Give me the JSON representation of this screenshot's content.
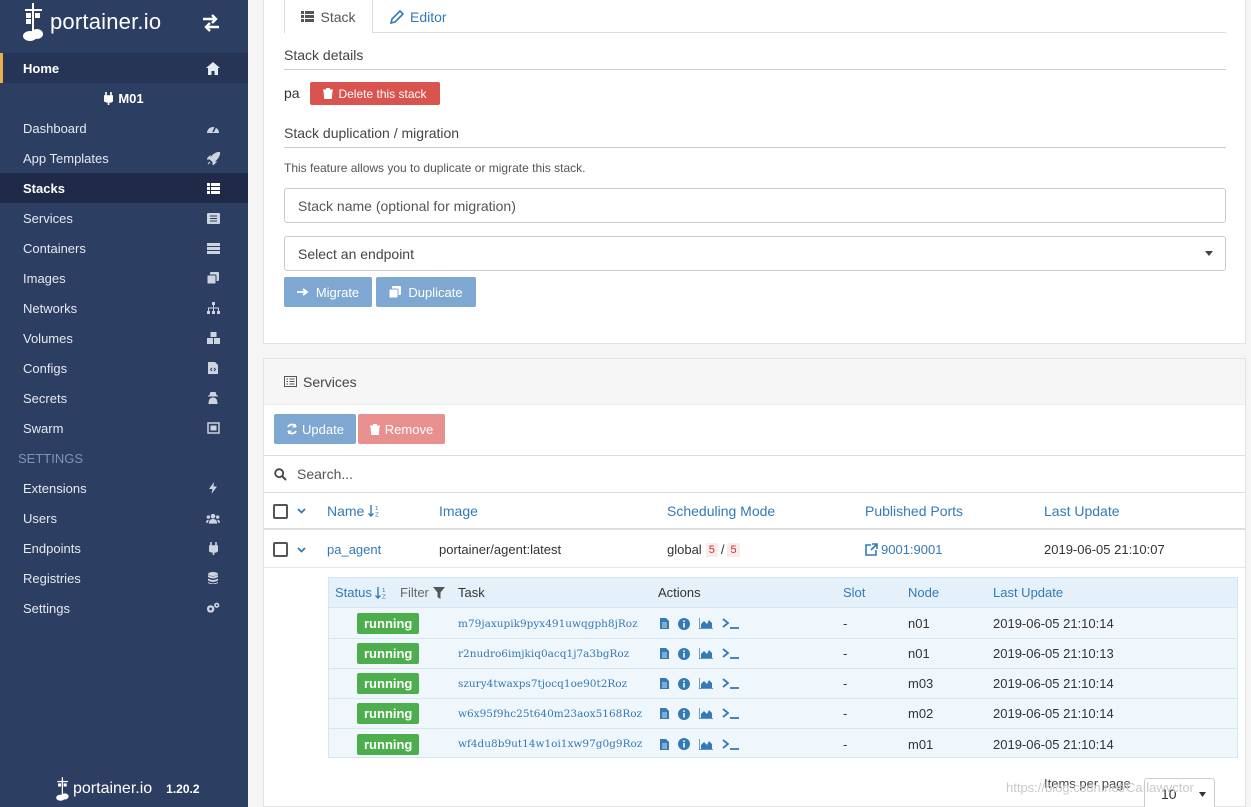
{
  "app": {
    "logo_text": "portainer.io",
    "version": "1.20.2"
  },
  "sidebar": {
    "home": "Home",
    "endpoint": "M01",
    "items": [
      {
        "label": "Dashboard",
        "icon": "tachometer-icon"
      },
      {
        "label": "App Templates",
        "icon": "rocket-icon"
      },
      {
        "label": "Stacks",
        "icon": "th-list-icon"
      },
      {
        "label": "Services",
        "icon": "list-alt-icon"
      },
      {
        "label": "Containers",
        "icon": "server-icon"
      },
      {
        "label": "Images",
        "icon": "clone-icon"
      },
      {
        "label": "Networks",
        "icon": "sitemap-icon"
      },
      {
        "label": "Volumes",
        "icon": "cubes-icon"
      },
      {
        "label": "Configs",
        "icon": "file-code-icon"
      },
      {
        "label": "Secrets",
        "icon": "user-secret-icon"
      },
      {
        "label": "Swarm",
        "icon": "object-group-icon"
      }
    ],
    "settings_header": "SETTINGS",
    "settings_items": [
      {
        "label": "Extensions",
        "icon": "bolt-icon"
      },
      {
        "label": "Users",
        "icon": "users-icon"
      },
      {
        "label": "Endpoints",
        "icon": "plug-icon"
      },
      {
        "label": "Registries",
        "icon": "database-icon"
      },
      {
        "label": "Settings",
        "icon": "cogs-icon"
      }
    ]
  },
  "stack_panel": {
    "tabs": {
      "stack": "Stack",
      "editor": "Editor"
    },
    "details_title": "Stack details",
    "stack_name": "pa",
    "delete_button": "Delete this stack",
    "duplication_title": "Stack duplication / migration",
    "help_text": "This feature allows you to duplicate or migrate this stack.",
    "name_placeholder": "Stack name (optional for migration)",
    "endpoint_select": "Select an endpoint",
    "migrate_button": "Migrate",
    "duplicate_button": "Duplicate"
  },
  "services_panel": {
    "title": "Services",
    "update_button": "Update",
    "remove_button": "Remove",
    "search_placeholder": "Search...",
    "columns": {
      "name": "Name",
      "image": "Image",
      "scheduling": "Scheduling Mode",
      "ports": "Published Ports",
      "last_update": "Last Update"
    },
    "service": {
      "name": "pa_agent",
      "image": "portainer/agent:latest",
      "mode": "global",
      "running": "5",
      "slash": "/",
      "desired": "5",
      "ports": "9001:9001",
      "last_update": "2019-06-05 21:10:07"
    },
    "task_columns": {
      "status": "Status",
      "filter": "Filter",
      "task": "Task",
      "actions": "Actions",
      "slot": "Slot",
      "node": "Node",
      "last_update": "Last Update"
    },
    "tasks": [
      {
        "status": "running",
        "id": "m79jaxupik9pyx491uwqgph8jRoz",
        "slot": "-",
        "node": "n01",
        "updated": "2019-06-05 21:10:14"
      },
      {
        "status": "running",
        "id": "r2nudro6imjkiq0acq1j7a3bgRoz",
        "slot": "-",
        "node": "n01",
        "updated": "2019-06-05 21:10:13"
      },
      {
        "status": "running",
        "id": "szury4twaxps7tjocq1oe90t2Roz",
        "slot": "-",
        "node": "m03",
        "updated": "2019-06-05 21:10:14"
      },
      {
        "status": "running",
        "id": "w6x95f9hc25t640m23aox5168Roz",
        "slot": "-",
        "node": "m02",
        "updated": "2019-06-05 21:10:14"
      },
      {
        "status": "running",
        "id": "wf4du8b9ut14w1oi1xw97g0g9Roz",
        "slot": "-",
        "node": "m01",
        "updated": "2019-06-05 21:10:14"
      }
    ],
    "items_per_page_label": "Items per page",
    "items_per_page": "10"
  },
  "watermark": "https://blog.csdn.net/CaIlawvctor",
  "colors": {
    "sidebar": "#2d3e63",
    "primary": "#337ab7",
    "danger": "#d9534f",
    "success": "#4cae4c"
  }
}
